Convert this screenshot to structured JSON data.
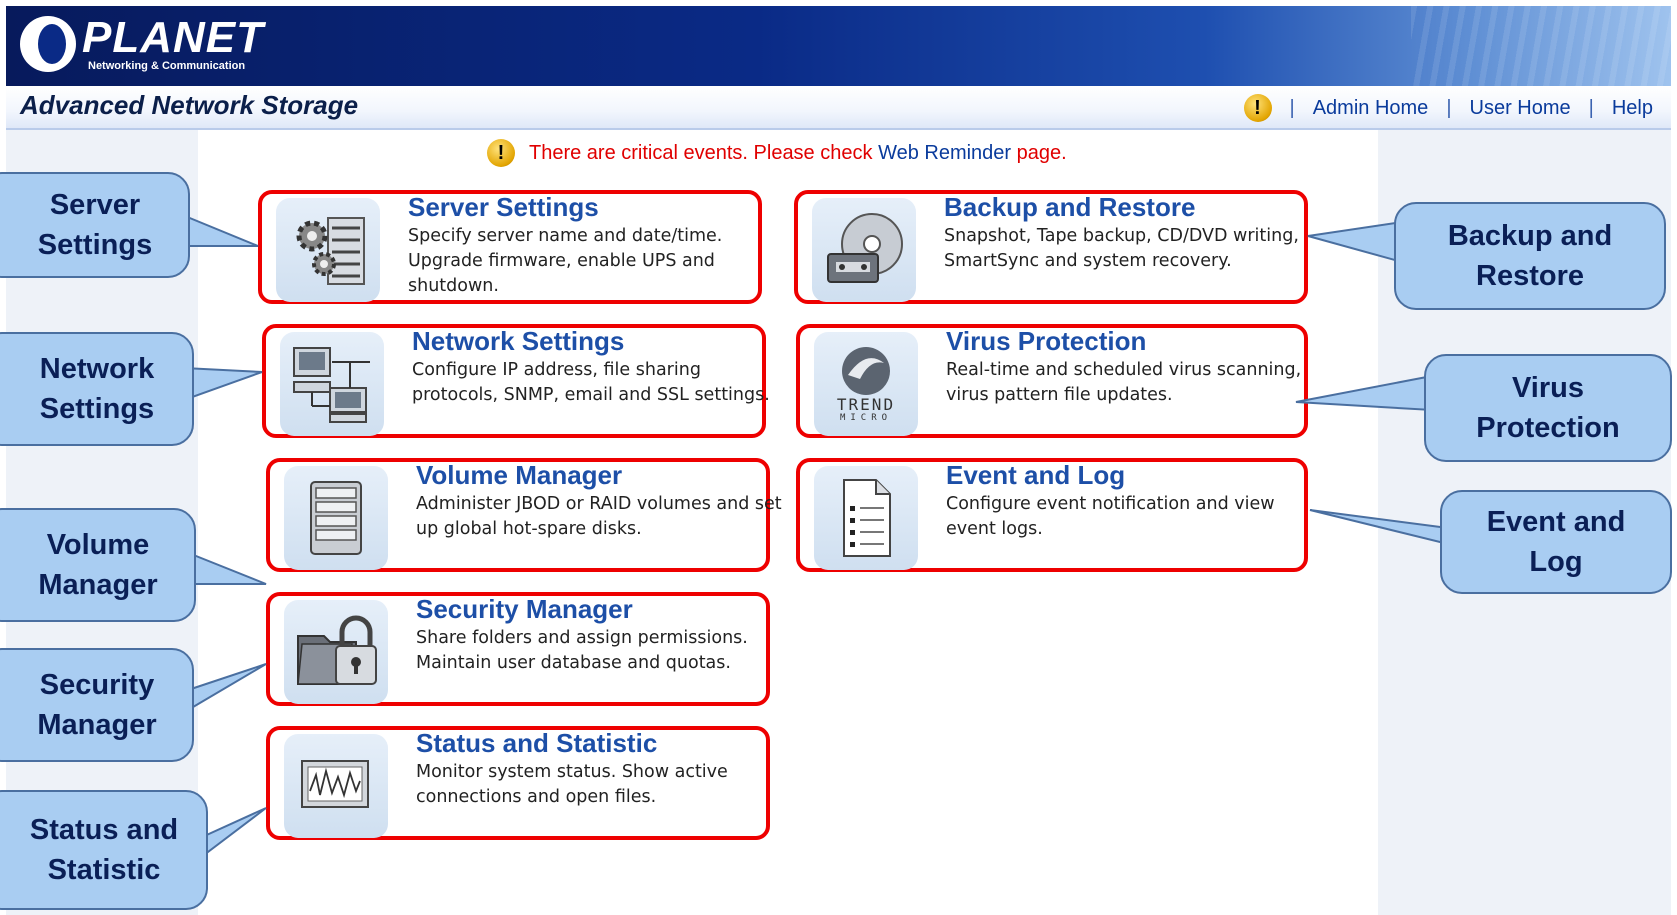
{
  "brand": {
    "logo_name": "PLANET",
    "logo_tagline": "Networking & Communication",
    "product_title": "Advanced Network Storage"
  },
  "topnav": {
    "warning_symbol": "!",
    "separator": "|",
    "admin_home": "Admin Home",
    "user_home": "User Home",
    "help": "Help"
  },
  "alert": {
    "message": "There are critical events. Please check",
    "link": "Web Reminder",
    "suffix": "page."
  },
  "cards": {
    "server_settings": {
      "title": "Server Settings",
      "description": "Specify server name and date/time. Upgrade firmware, enable UPS and shutdown.",
      "icon": "server-gears-icon"
    },
    "network_settings": {
      "title": "Network Settings",
      "description": "Configure IP address, file sharing protocols, SNMP, email and SSL settings.",
      "icon": "network-computers-icon"
    },
    "volume_manager": {
      "title": "Volume Manager",
      "description": "Administer JBOD or RAID volumes and set up global hot-spare disks.",
      "icon": "disk-stack-icon"
    },
    "security_manager": {
      "title": "Security Manager",
      "description": "Share folders and assign permissions. Maintain user database and quotas.",
      "icon": "folder-lock-icon"
    },
    "status_statistic": {
      "title": "Status and Statistic",
      "description": "Monitor system status. Show active connections and open files.",
      "icon": "monitor-chart-icon"
    },
    "backup_restore": {
      "title": "Backup and Restore",
      "description": "Snapshot, Tape backup, CD/DVD writing, SmartSync and system recovery.",
      "icon": "disc-tape-icon"
    },
    "virus_protection": {
      "title": "Virus Protection",
      "description": "Real-time and scheduled virus scanning, virus pattern file updates.",
      "icon": "trend-micro-icon",
      "logo_line1": "TREND",
      "logo_line2": "MICRO"
    },
    "event_log": {
      "title": "Event and Log",
      "description": "Configure event notification and view event logs.",
      "icon": "document-list-icon"
    }
  },
  "callouts": {
    "server_settings": {
      "line1": "Server",
      "line2": "Settings"
    },
    "network_settings": {
      "line1": "Network",
      "line2": "Settings"
    },
    "volume_manager": {
      "line1": "Volume",
      "line2": "Manager"
    },
    "security_manager": {
      "line1": "Security",
      "line2": "Manager"
    },
    "status_statistic": {
      "line1": "Status and",
      "line2": "Statistic"
    },
    "backup_restore": {
      "line1": "Backup and",
      "line2": "Restore"
    },
    "virus_protection": {
      "line1": "Virus",
      "line2": "Protection"
    },
    "event_log": {
      "line1": "Event and",
      "line2": "Log"
    }
  },
  "colors": {
    "highlight_border": "#ee0000",
    "card_title": "#1d4fa7",
    "callout_fill": "#a9cdf2",
    "alert_text": "#e00000"
  }
}
